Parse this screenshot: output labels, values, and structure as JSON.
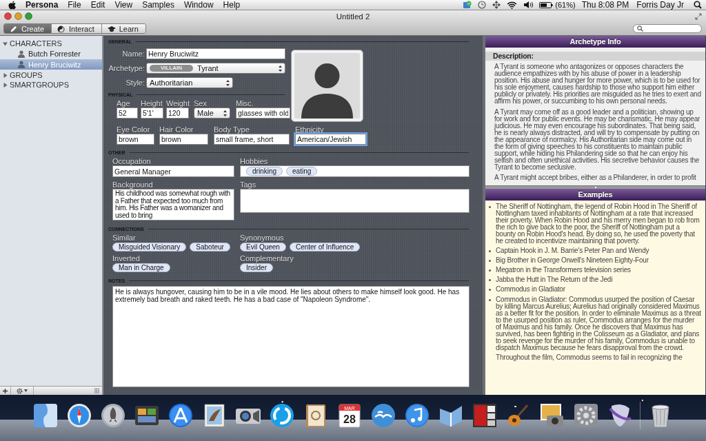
{
  "menu_bar": {
    "app": "Persona",
    "items": [
      "File",
      "Edit",
      "View",
      "Samples",
      "Window",
      "Help"
    ],
    "battery": "(61%)",
    "clock": "Thu 8:08 PM",
    "user": "Forris Day Jr"
  },
  "window": {
    "title": "Untitled 2"
  },
  "modes": [
    {
      "label": "Create",
      "selected": true
    },
    {
      "label": "Interact",
      "selected": false
    },
    {
      "label": "Learn",
      "selected": false
    }
  ],
  "sidebar": {
    "groups": [
      {
        "label": "CHARACTERS",
        "expanded": true,
        "children": [
          {
            "label": "Butch Forrester",
            "selected": false
          },
          {
            "label": "Henry Bruciwitz",
            "selected": true
          }
        ]
      },
      {
        "label": "GROUPS",
        "expanded": false
      },
      {
        "label": "SMARTGROUPS",
        "expanded": false
      }
    ]
  },
  "general": {
    "heading": "GENERAL",
    "name": {
      "label": "Name:",
      "value": "Henry Bruciwitz"
    },
    "archetype": {
      "label": "Archetype:",
      "badge": "VILLAIN",
      "value": "Tyrant"
    },
    "style": {
      "label": "Style:",
      "value": "Authoritarian"
    }
  },
  "physical": {
    "heading": "PHYSICAL",
    "rows": [
      {
        "fields": [
          {
            "kind": "text",
            "label": "Age",
            "value": "52",
            "focused": false
          },
          {
            "kind": "text",
            "label": "Height",
            "value": "5'1'",
            "focused": false
          },
          {
            "kind": "text",
            "label": "Weight",
            "value": "120",
            "focused": false
          },
          {
            "kind": "select",
            "label": "Sex",
            "value": "Male",
            "focused": false
          },
          {
            "kind": "text",
            "label": "Misc.",
            "value": "glasses with old",
            "focused": false
          }
        ]
      },
      {
        "fields": [
          {
            "kind": "text",
            "label": "Eye Color",
            "value": "brown",
            "focused": false
          },
          {
            "kind": "text",
            "label": "Hair Color",
            "value": "brown",
            "focused": false
          },
          {
            "kind": "text",
            "label": "Body Type",
            "value": "small frame, short",
            "focused": false
          },
          {
            "kind": "text",
            "label": "Ethnicity",
            "value": "American/Jewish",
            "focused": true
          }
        ]
      }
    ]
  },
  "other": {
    "heading": "OTHER",
    "occupation": {
      "label": "Occupation",
      "value": "General Manager"
    },
    "hobbies": {
      "label": "Hobbies",
      "tokens": [
        "drinking",
        "eating"
      ]
    },
    "background": {
      "label": "Background",
      "value": "His childhood was somewhat rough with a Father that expected too much from him. His Father was a womanizer and used to bring"
    },
    "tags": {
      "label": "Tags"
    }
  },
  "connections": {
    "heading": "CONNECTIONS",
    "groups": [
      {
        "label": "Similar",
        "tokens": [
          "Misguided Visionary",
          "Saboteur"
        ]
      },
      {
        "label": "Synonymous",
        "tokens": [
          "Evil Queen",
          "Center of Influence"
        ]
      },
      {
        "label": "Inverted",
        "tokens": [
          "Man in Charge"
        ]
      },
      {
        "label": "Complementary",
        "tokens": [
          "Insider"
        ]
      }
    ]
  },
  "notes": {
    "heading": "NOTES",
    "text": "He is always hungover, causing him to be in a vile mood. He lies about others to make himself look good. He has extremely bad breath and raked teeth. He has a bad case of \"Napoleon Syndrome\"."
  },
  "archetype_info": {
    "title": "Archetype Info",
    "description_label": "Description:",
    "paragraphs": [
      "A Tyrant is someone who antagonizes or opposes characters the audience empathizes with by his abuse of power in a leadership position. His abuse and hunger for more power, which is to be used for his sole enjoyment, causes hardship to those who support him either publicly or privately. His priorities are misguided as he tries to exert and affirm his power, or succumbing to his own personal needs.",
      "A Tyrant may come off as a good leader and a politician, showing up for work and for public events. He may be charismatic. He may appear judicious. He may even encourage his subordinates. That being said, he is nearly always distracted, and will try to compensate by putting on the appearance of normalcy. His Authoritarian side may come out in the form of giving speeches to his constituents to maintain public support, while hiding his Philandering side so that he can enjoy his selfish and often unethical activities. His secretive behavior causes the Tyrant to become seclusive.",
      "A Tyrant might accept bribes, either as a Philanderer, in order to profit"
    ],
    "examples_title": "Examples",
    "examples": [
      {
        "paragraphs": [
          "The Sheriff of Nottingham, the legend of Robin Hood in The Sheriff of Nottingham taxed inhabitants of Nottingham at a rate that increased their poverty. When Robin Hood and his merry men began to rob from the rich to give back to the poor, the Sheriff of Nottingham put a bounty on Robin Hood's head. By doing so, he used the poverty that he created to incentivize maintaining that poverty."
        ]
      },
      {
        "paragraphs": [
          "Captain Hook in J. M. Barrie's Peter Pan and Wendy"
        ]
      },
      {
        "paragraphs": [
          "Big Brother in George Orwell's Nineteen Eighty-Four"
        ]
      },
      {
        "paragraphs": [
          "Megatron in the Transformers television series"
        ]
      },
      {
        "paragraphs": [
          "Jabba the Hutt in The Return of the Jedi"
        ]
      },
      {
        "paragraphs": [
          "Commodus in Gladiator"
        ]
      },
      {
        "paragraphs": [
          "Commodus in Gladiator: Commodus usurped the position of Caesar by killing Marcus Aurelius; Aurelius had originally considered Maximus as a better fit for the position. In order to eliminate Maximus as a threat to the usurped position as ruler, Commodus arranges for the murder of Maximus and his family. Once he discovers that Maximus has survived, has been fighting in the Colisseum as a Gladiator, and plans to seek revenge for the murder of his family, Commodus is unable to dispatch Maximus because he fears disapproval from the crowd.",
          "Throughout the film, Commodus seems to fail in recognizing the"
        ]
      }
    ]
  },
  "dock": {
    "calendar": {
      "month": "MAR",
      "day": "28"
    }
  }
}
